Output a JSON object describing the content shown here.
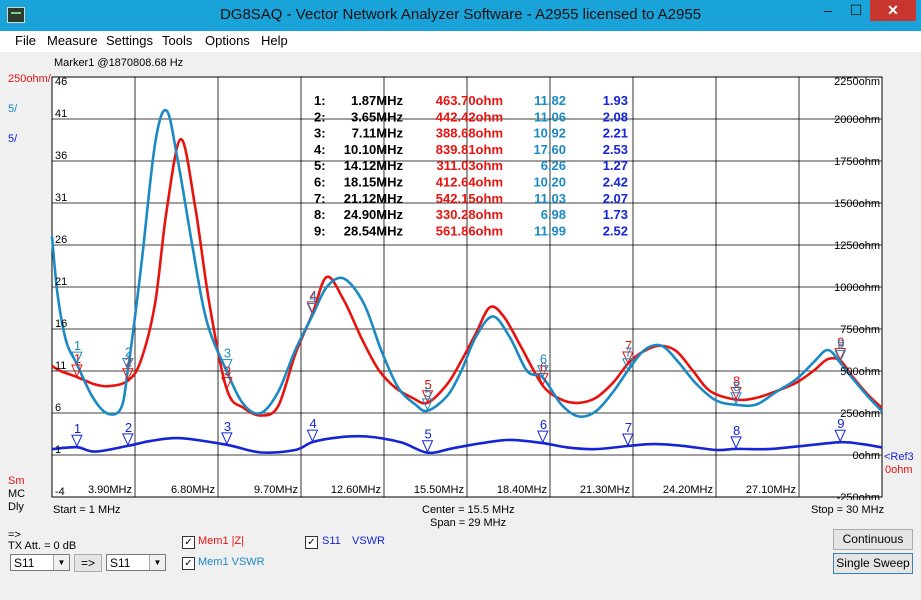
{
  "window": {
    "title": "DG8SAQ  -  Vector Network Analyzer Software  -  A2955 licensed to A2955",
    "min": "–",
    "max": "☐",
    "close": "✕"
  },
  "menu": [
    "File",
    "Measure",
    "Settings",
    "Tools",
    "Options",
    "Help"
  ],
  "marker_readout": "Marker1 @1870808.68 Hz",
  "colors": {
    "red": "#e8130f",
    "cyan": "#1b8ac4",
    "blue": "#1525d6",
    "dark": "#000000"
  },
  "left_axis": {
    "head1": "250ohm/",
    "head2": "5/",
    "head3": "5/",
    "ticks": [
      "46",
      "41",
      "36",
      "31",
      "26",
      "21",
      "16",
      "11",
      "6",
      "1",
      "-4"
    ],
    "foot": [
      "Sm",
      "MC",
      "Dly"
    ]
  },
  "right_axis": {
    "ticks": [
      "2250ohm",
      "2000ohm",
      "1750ohm",
      "1500ohm",
      "1250ohm",
      "1000ohm",
      "750ohm",
      "500ohm",
      "250ohm",
      "0ohm",
      "-250ohm"
    ],
    "ref_label": "<Ref3",
    "ref_value": "0ohm"
  },
  "x_axis": {
    "ticks": [
      "3.90MHz",
      "6.80MHz",
      "9.70MHz",
      "12.60MHz",
      "15.50MHz",
      "18.40MHz",
      "21.30MHz",
      "24.20MHz",
      "27.10MHz"
    ],
    "start": "Start = 1 MHz",
    "center": "Center = 15.5 MHz",
    "span": "Span = 29 MHz",
    "stop": "Stop = 30 MHz"
  },
  "marker_table": [
    {
      "n": "1:",
      "f": "1.87MHz",
      "z": "463.70ohm",
      "c": "11.82",
      "v": "1.93"
    },
    {
      "n": "2:",
      "f": "3.65MHz",
      "z": "442.42ohm",
      "c": "11.06",
      "v": "2.08"
    },
    {
      "n": "3:",
      "f": "7.11MHz",
      "z": "388.68ohm",
      "c": "10.92",
      "v": "2.21"
    },
    {
      "n": "4:",
      "f": "10.10MHz",
      "z": "839.81ohm",
      "c": "17.60",
      "v": "2.53"
    },
    {
      "n": "5:",
      "f": "14.12MHz",
      "z": "311.03ohm",
      "c": "6.26",
      "v": "1.27"
    },
    {
      "n": "6:",
      "f": "18.15MHz",
      "z": "412.64ohm",
      "c": "10.20",
      "v": "2.42"
    },
    {
      "n": "7:",
      "f": "21.12MHz",
      "z": "542.15ohm",
      "c": "11.03",
      "v": "2.07"
    },
    {
      "n": "8:",
      "f": "24.90MHz",
      "z": "330.28ohm",
      "c": "6.98",
      "v": "1.73"
    },
    {
      "n": "9:",
      "f": "28.54MHz",
      "z": "561.86ohm",
      "c": "11.99",
      "v": "2.52"
    }
  ],
  "chart_data": {
    "type": "line",
    "xlim": [
      1,
      30
    ],
    "x_unit": "MHz",
    "left_ylim": [
      -4,
      46
    ],
    "right_ylim": [
      -250,
      2250
    ],
    "series": [
      {
        "name": "Mem1 |Z|",
        "color": "red",
        "axis": "right",
        "x": [
          1,
          1.3,
          1.87,
          2.5,
          3.0,
          3.65,
          4.1,
          4.6,
          5.0,
          5.5,
          6.0,
          6.5,
          7.11,
          7.7,
          8.3,
          8.9,
          9.5,
          10.1,
          10.6,
          11.2,
          11.8,
          12.4,
          13.0,
          13.6,
          14.12,
          14.8,
          15.3,
          15.8,
          16.3,
          16.8,
          17.4,
          18.15,
          18.8,
          19.4,
          20.0,
          20.6,
          21.12,
          21.6,
          22.2,
          22.8,
          23.4,
          24.0,
          24.9,
          25.6,
          26.3,
          27.0,
          27.6,
          28.1,
          28.54,
          29.0,
          29.5,
          30
        ],
        "y": [
          530,
          500,
          464,
          420,
          410,
          442,
          560,
          900,
          1450,
          1880,
          1480,
          900,
          389,
          280,
          235,
          290,
          600,
          840,
          1060,
          920,
          700,
          510,
          400,
          340,
          311,
          420,
          560,
          720,
          880,
          820,
          640,
          413,
          330,
          310,
          340,
          430,
          542,
          610,
          650,
          620,
          500,
          380,
          330,
          340,
          380,
          430,
          500,
          570,
          562,
          460,
          360,
          280
        ]
      },
      {
        "name": "Mem1 VSWR",
        "color": "cyan",
        "axis": "left",
        "x": [
          1,
          1.2,
          1.5,
          1.87,
          2.4,
          2.9,
          3.4,
          3.65,
          4.1,
          4.6,
          5.0,
          5.4,
          5.9,
          6.4,
          7.11,
          7.7,
          8.3,
          8.9,
          9.5,
          10.1,
          10.6,
          11.2,
          11.9,
          12.5,
          13.1,
          13.7,
          14.12,
          14.8,
          15.3,
          15.8,
          16.4,
          17.0,
          17.6,
          18.15,
          18.8,
          19.4,
          20.0,
          20.6,
          21.12,
          21.7,
          22.3,
          22.9,
          23.5,
          24.2,
          24.9,
          25.6,
          26.3,
          27.0,
          27.6,
          28.1,
          28.54,
          29.0,
          29.5,
          30
        ],
        "y": [
          27,
          20,
          14.5,
          11.82,
          8,
          6,
          6.5,
          11.06,
          23,
          38,
          42,
          36,
          26,
          17,
          10.92,
          7,
          6,
          8.5,
          13.5,
          17.6,
          21,
          22,
          19,
          13.5,
          9,
          7,
          6.26,
          8,
          11,
          15,
          17.5,
          15,
          11,
          10.2,
          7,
          5.6,
          6.2,
          8.5,
          11.03,
          13.5,
          14,
          12,
          9.5,
          7.5,
          6.98,
          7,
          8.5,
          10,
          12,
          13.5,
          11.99,
          10,
          8,
          6.2
        ]
      },
      {
        "name": "VSWR",
        "color": "blue",
        "axis": "left",
        "x": [
          1,
          1.87,
          2.5,
          3.65,
          4.5,
          5.5,
          7.11,
          8.3,
          9.5,
          10.1,
          11,
          12,
          13.2,
          14.12,
          15,
          16,
          17,
          18.15,
          19,
          20,
          21.12,
          22,
          23,
          24.2,
          24.9,
          26,
          27,
          28.54,
          29.3,
          30
        ],
        "y": [
          1.7,
          1.93,
          1.4,
          2.08,
          2.7,
          3,
          2.21,
          1.3,
          1.6,
          2.53,
          3.1,
          3.2,
          2.5,
          1.27,
          1.8,
          2.4,
          2.8,
          2.42,
          1.9,
          1.7,
          2.07,
          2.3,
          2.1,
          1.6,
          1.73,
          1.7,
          2.0,
          2.52,
          2.3,
          1.9
        ]
      }
    ],
    "markers": [
      {
        "label": "1",
        "x": 1.87
      },
      {
        "label": "2",
        "x": 3.65
      },
      {
        "label": "3",
        "x": 7.11
      },
      {
        "label": "4",
        "x": 10.1
      },
      {
        "label": "5",
        "x": 14.12
      },
      {
        "label": "6",
        "x": 18.15
      },
      {
        "label": "7",
        "x": 21.12
      },
      {
        "label": "8",
        "x": 24.9
      },
      {
        "label": "9",
        "x": 28.54
      }
    ]
  },
  "legend": {
    "mem1z": "Mem1 |Z|",
    "mem1vswr": "Mem1 VSWR",
    "s11": "S11",
    "vswr": "VSWR"
  },
  "controls": {
    "arrow_lbl": "=>",
    "tx_att": "TX Att. = 0 dB",
    "combo1": "S11",
    "copy_btn": "=>",
    "combo2": "S11",
    "continuous": "Continuous",
    "single": "Single Sweep"
  }
}
